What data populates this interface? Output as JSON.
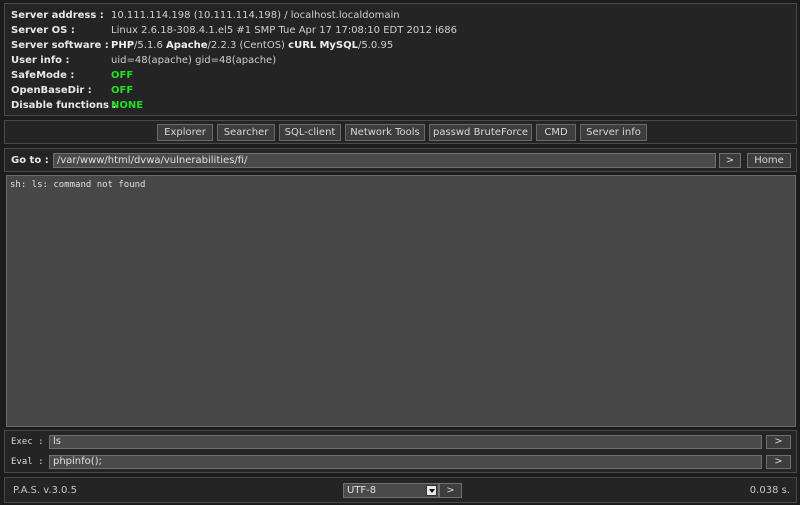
{
  "server_info": {
    "rows": [
      {
        "label": "Server address :",
        "value": "10.111.114.198 (10.111.114.198) / localhost.localdomain"
      },
      {
        "label": "Server OS :",
        "value": "Linux 2.6.18-308.4.1.el5 #1 SMP Tue Apr 17 17:08:10 EDT 2012 i686"
      },
      {
        "label": "Server software :",
        "parts": {
          "php": "PHP",
          "php_ver": "/5.1.6",
          "apache": "Apache",
          "apache_ver": "/2.2.3 (CentOS)",
          "curl": "cURL",
          "mysql": "MySQL",
          "mysql_ver": "/5.0.95"
        }
      },
      {
        "label": "User info :",
        "value": "uid=48(apache) gid=48(apache)"
      },
      {
        "label": "SafeMode :",
        "value": "OFF"
      },
      {
        "label": "OpenBaseDir :",
        "value": "OFF"
      },
      {
        "label": "Disable functions :",
        "value": "NONE"
      }
    ],
    "status_color": "#21e021"
  },
  "nav": {
    "buttons": [
      "Explorer",
      "Searcher",
      "SQL-client",
      "Network Tools",
      "passwd BruteForce",
      "CMD",
      "Server info"
    ]
  },
  "goto": {
    "label": "Go to :",
    "path": "/var/www/html/dvwa/vulnerabilities/fi/",
    "go_label": ">",
    "home_label": "Home"
  },
  "output": {
    "text": "sh: ls: command not found"
  },
  "exec": {
    "label": "Exec :",
    "value": "ls",
    "run_label": ">"
  },
  "eval": {
    "label": "Eval :",
    "value": "phpinfo();",
    "run_label": ">"
  },
  "footer": {
    "version": "P.A.S. v.3.0.5",
    "encoding": "UTF-8",
    "go_label": ">",
    "timing": "0.038 s."
  }
}
